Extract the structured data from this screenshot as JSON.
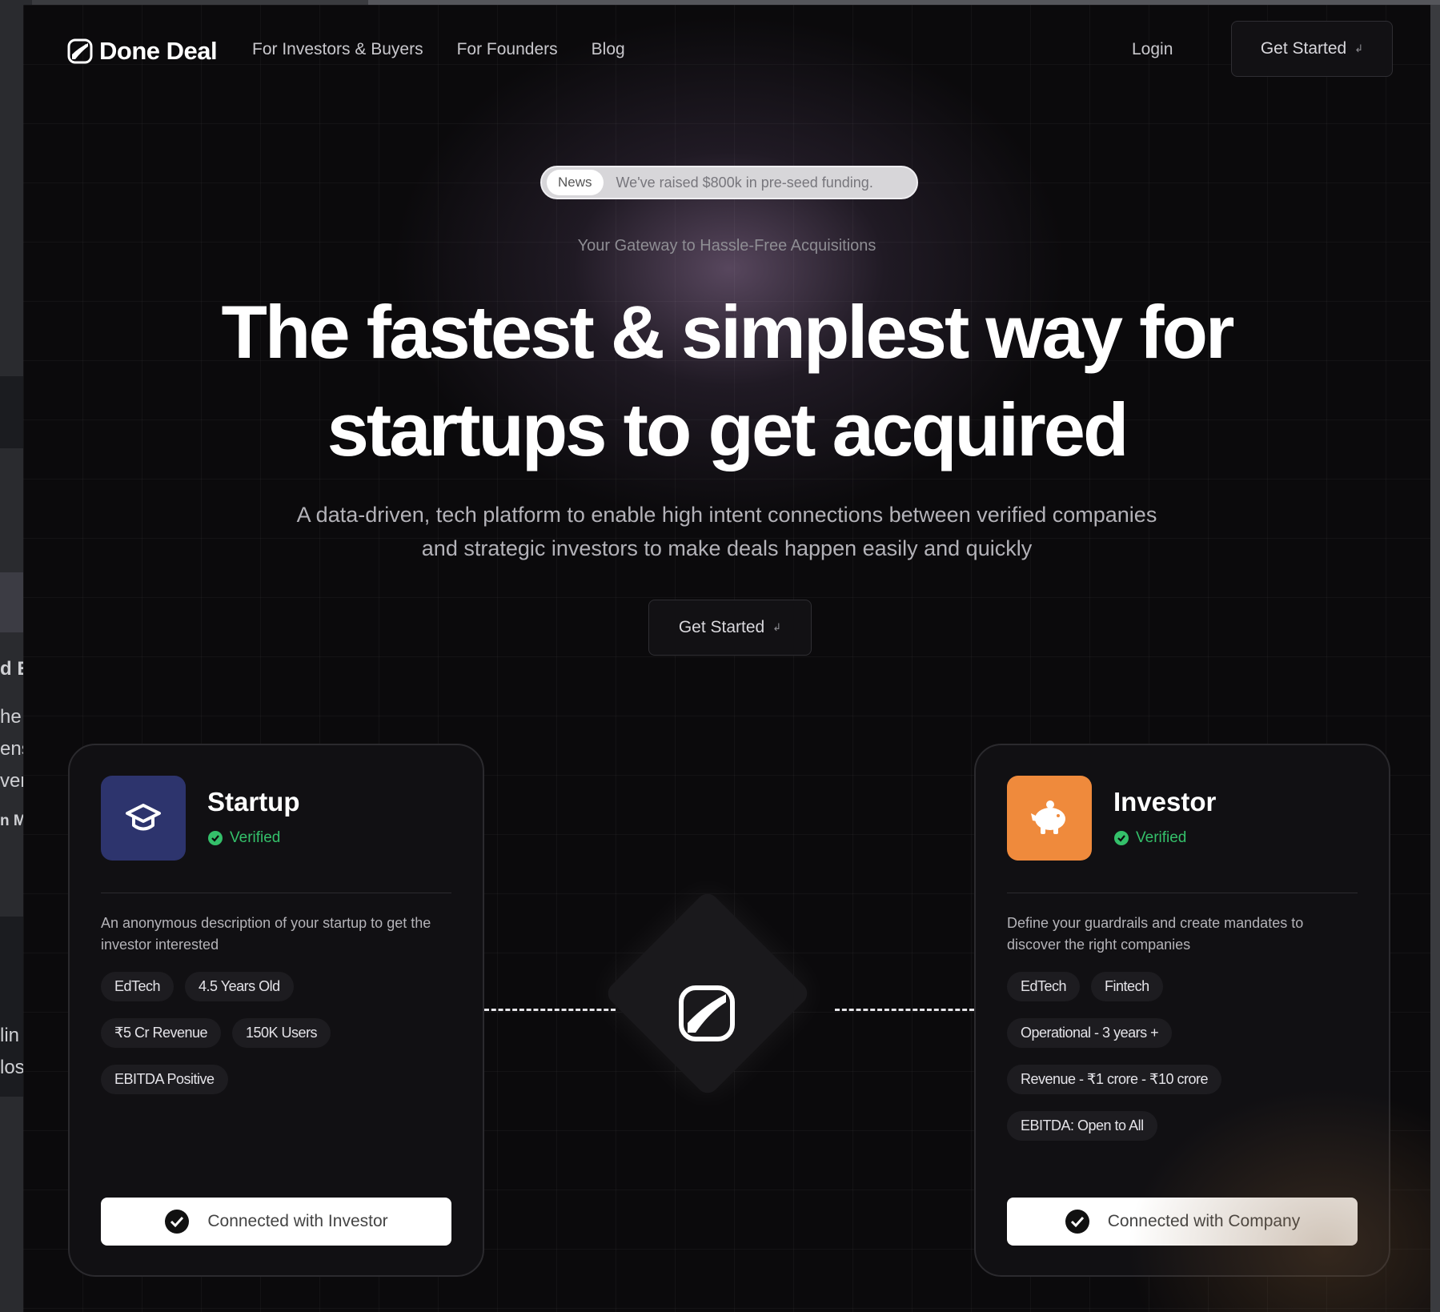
{
  "background_window": {
    "fragments": [
      "d E",
      "he",
      "ens",
      "ver",
      "n M",
      "lin",
      "los"
    ]
  },
  "header": {
    "brand": "Done Deal",
    "nav": [
      {
        "label": "For Investors & Buyers"
      },
      {
        "label": "For Founders"
      },
      {
        "label": "Blog"
      }
    ],
    "login_label": "Login",
    "cta_label": "Get Started"
  },
  "hero": {
    "news_tag": "News",
    "news_text": "We've raised $800k in pre-seed funding.",
    "tagline": "Your Gateway to Hassle-Free Acquisitions",
    "headline_line1": "The fastest & simplest way for",
    "headline_line2": "startups to get acquired",
    "subtitle_line1": "A data-driven, tech platform to enable high intent connections between verified companies",
    "subtitle_line2": "and strategic investors to make deals happen easily and quickly",
    "cta_label": "Get Started"
  },
  "startup_card": {
    "icon": "graduation-cap-icon",
    "title": "Startup",
    "verified": "Verified",
    "description": "An anonymous description of your startup to get the investor interested",
    "chips": [
      [
        "EdTech",
        "4.5 Years Old"
      ],
      [
        "₹5 Cr Revenue",
        "150K Users"
      ],
      [
        "EBITDA Positive"
      ]
    ],
    "connect_label": "Connected with Investor"
  },
  "investor_card": {
    "icon": "piggy-bank-icon",
    "title": "Investor",
    "verified": "Verified",
    "description": "Define your guardrails and create mandates to discover the right companies",
    "chips": [
      [
        "EdTech",
        "Fintech"
      ],
      [
        "Operational - 3 years +"
      ],
      [
        "Revenue - ₹1 crore - ₹10 crore"
      ],
      [
        "EBITDA: Open to All"
      ]
    ],
    "connect_label": "Connected with Company"
  },
  "colors": {
    "page_bg": "#0b0a0c",
    "verified_green": "#34c06a",
    "startup_icon_bg": "#2d346d",
    "investor_icon_bg": "#ef8a3c"
  }
}
